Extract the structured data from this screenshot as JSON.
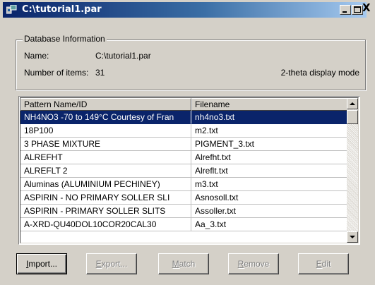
{
  "window": {
    "title": "C:\\tutorial1.par",
    "controls": [
      "minimize-icon",
      "maximize-icon",
      "close-icon"
    ],
    "close_glyph": "X"
  },
  "database_info": {
    "legend": "Database Information",
    "name_label": "Name:",
    "name_value": "C:\\tutorial1.par",
    "items_label": "Number of items:",
    "items_value": "31",
    "display_mode": "2-theta display mode"
  },
  "list": {
    "columns": [
      "Pattern Name/ID",
      "Filename"
    ],
    "rows": [
      {
        "name": "NH4NO3 -70 to 149°C Courtesy of Fran",
        "file": "nh4no3.txt",
        "selected": true
      },
      {
        "name": "18P100",
        "file": "m2.txt",
        "selected": false
      },
      {
        "name": "3 PHASE MIXTURE",
        "file": "PIGMENT_3.txt",
        "selected": false
      },
      {
        "name": "ALREFHT",
        "file": "Alrefht.txt",
        "selected": false
      },
      {
        "name": "ALREFLT 2",
        "file": "Alreflt.txt",
        "selected": false
      },
      {
        "name": "Aluminas (ALUMINIUM PECHINEY)",
        "file": "m3.txt",
        "selected": false
      },
      {
        "name": "ASPIRIN - NO PRIMARY SOLLER SLI",
        "file": "Asnosoll.txt",
        "selected": false
      },
      {
        "name": "ASPIRIN - PRIMARY SOLLER SLITS",
        "file": "Assoller.txt",
        "selected": false
      },
      {
        "name": "A-XRD-QU40DOL10COR20CAL30",
        "file": "Aa_3.txt",
        "selected": false
      }
    ]
  },
  "buttons": {
    "import": {
      "first": "I",
      "rest": "mport...",
      "enabled": true
    },
    "export": {
      "first": "E",
      "rest": "xport...",
      "enabled": false
    },
    "match": {
      "first": "M",
      "rest": "atch",
      "enabled": false
    },
    "remove": {
      "first": "R",
      "rest": "emove",
      "enabled": false
    },
    "edit": {
      "first": "E",
      "rest": "dit",
      "enabled": false
    }
  },
  "colors": {
    "title_gradient_start": "#0a246a",
    "title_gradient_end": "#a6caf0",
    "selection": "#0a246a",
    "face": "#d4d0c8"
  }
}
